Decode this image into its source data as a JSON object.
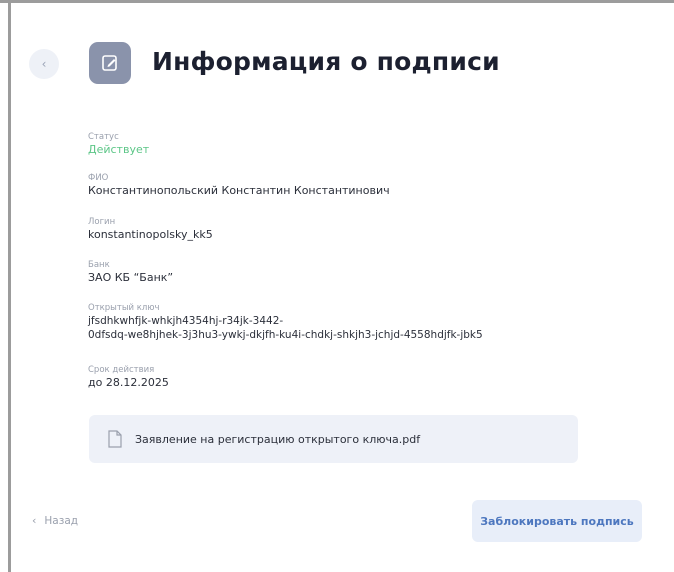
{
  "header": {
    "back_icon": "chevron-left-icon",
    "title_icon": "edit-document-icon",
    "title": "Информация о подписи"
  },
  "fields": {
    "status": {
      "label": "Статус",
      "value": "Действует"
    },
    "fio": {
      "label": "ФИО",
      "value": "Константинопольский Константин Константинович"
    },
    "login": {
      "label": "Логин",
      "value": "konstantinopolsky_kk5"
    },
    "bank": {
      "label": "Банк",
      "value": "ЗАО КБ “Банк”"
    },
    "public_key": {
      "label": "Открытый ключ",
      "line1": "jfsdhkwhfjk-whkjh4354hj-r34jk-3442-",
      "line2": "0dfsdq-we8hjhek-3j3hu3-ywkj-dkjfh-ku4i-chdkj-shkjh3-jchjd-4558hdjfk-jbk5"
    },
    "validity": {
      "label": "Срок действия",
      "value": "до 28.12.2025"
    }
  },
  "attachment": {
    "icon": "file-icon",
    "filename": "Заявление на регистрацию открытого ключа.pdf"
  },
  "footer": {
    "back_label": "Назад",
    "block_button_label": "Заблокировать подпись"
  },
  "colors": {
    "status_active": "#5cc687",
    "accent": "#4d77bf",
    "icon_bg": "#8a93ab"
  }
}
